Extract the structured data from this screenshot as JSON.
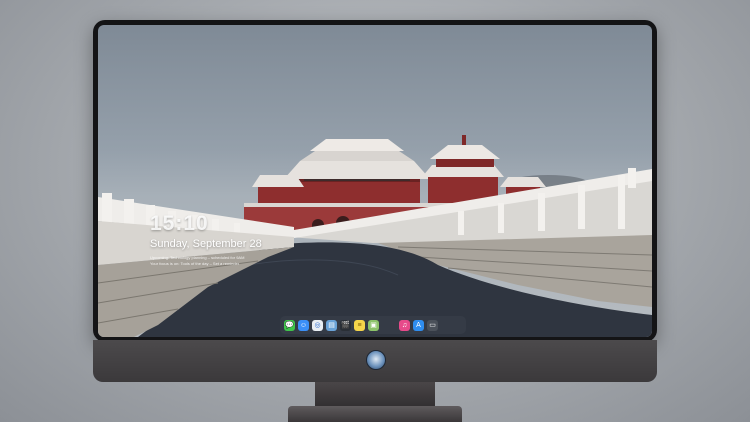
{
  "lock_screen": {
    "time": "15:10",
    "date": "Sunday, September 28",
    "notes": [
      "Upcoming: Technology planning – scheduled for 9AM",
      "Your focus is on: Tools of the day – Set a reminder"
    ]
  },
  "dock": {
    "items": [
      {
        "name": "messages-icon",
        "color": "#3fc54b",
        "glyph": "💬"
      },
      {
        "name": "finder-icon",
        "color": "#3b8ff6",
        "glyph": "☺"
      },
      {
        "name": "safari-icon",
        "color": "#e9eef3",
        "glyph": "◎"
      },
      {
        "name": "preview-icon",
        "color": "#6aa3d8",
        "glyph": "▤"
      },
      {
        "name": "clapper-icon",
        "color": "#2a2f36",
        "glyph": "🎬"
      },
      {
        "name": "notes-icon",
        "color": "#f5d54a",
        "glyph": "≡"
      },
      {
        "name": "photos-icon",
        "color": "#8cc36a",
        "glyph": "▣"
      },
      {
        "name": "music-icon",
        "color": "#e74a8a",
        "glyph": "♫"
      },
      {
        "name": "app-store-icon",
        "color": "#2f8ef0",
        "glyph": "A"
      },
      {
        "name": "screen-icon",
        "color": "#4b515a",
        "glyph": "▭"
      }
    ]
  },
  "colors": {
    "sky": "#8e99a4",
    "wall": "#9e3b3b",
    "roof_snow": "#e9e6e2",
    "water": "#2e3440"
  }
}
